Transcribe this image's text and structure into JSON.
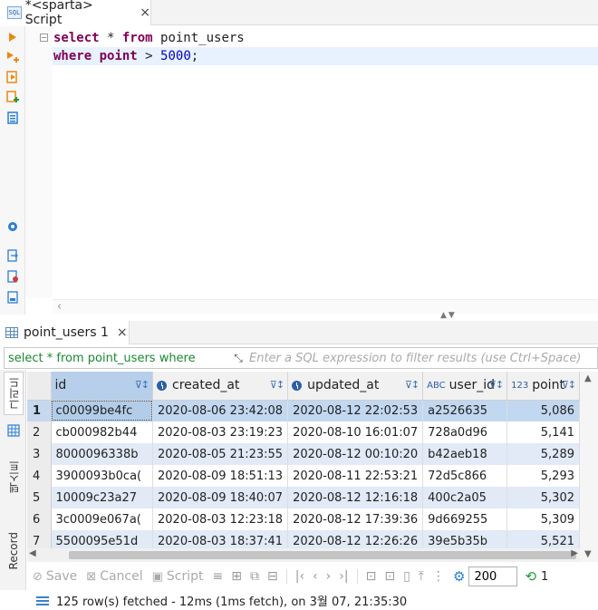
{
  "editor_tab": {
    "title": "*<sparta> Script",
    "close_glyph": "×"
  },
  "editor": {
    "lines": [
      {
        "kw1": "select",
        "text1": " * ",
        "kw2": "from",
        "text2": " point_users"
      },
      {
        "kw1": "where",
        "text1": " ",
        "kw2": "point",
        "text2": " > ",
        "num": "5000",
        "end": ";"
      }
    ]
  },
  "results_tab": {
    "title": "point_users 1",
    "close_glyph": "×"
  },
  "filter": {
    "query_text": "select * from point_users where",
    "placeholder": "Enter a SQL expression to filter results (use Ctrl+Space)"
  },
  "side_tabs": {
    "grid_label": "그리드",
    "text_label": "텍스트",
    "record_label": "Record"
  },
  "grid": {
    "columns": [
      {
        "label": "id",
        "icon": ""
      },
      {
        "label": "created_at",
        "icon": "clock"
      },
      {
        "label": "updated_at",
        "icon": "clock"
      },
      {
        "label": "user_id",
        "icon": "ABC"
      },
      {
        "label": "point",
        "icon": "123"
      }
    ],
    "rows": [
      {
        "n": "1",
        "id": "c00099be4fc",
        "created_at": "2020-08-06 23:42:08",
        "updated_at": "2020-08-12 22:02:53",
        "user_id": "a2526635",
        "point": "5,086"
      },
      {
        "n": "2",
        "id": "cb000982b44",
        "created_at": "2020-08-03 23:19:23",
        "updated_at": "2020-08-10 16:01:07",
        "user_id": "728a0d96",
        "point": "5,141"
      },
      {
        "n": "3",
        "id": "8000096338b",
        "created_at": "2020-08-05 21:23:55",
        "updated_at": "2020-08-12 00:10:20",
        "user_id": "b42aeb18",
        "point": "5,289"
      },
      {
        "n": "4",
        "id": "3900093b0ca(",
        "created_at": "2020-08-09 18:51:13",
        "updated_at": "2020-08-11 22:53:21",
        "user_id": "72d5c866",
        "point": "5,293"
      },
      {
        "n": "5",
        "id": "10009c23a27",
        "created_at": "2020-08-09 18:40:07",
        "updated_at": "2020-08-12 12:16:18",
        "user_id": "400c2a05",
        "point": "5,302"
      },
      {
        "n": "6",
        "id": "3c0009e067a(",
        "created_at": "2020-08-03 12:23:18",
        "updated_at": "2020-08-12 17:39:36",
        "user_id": "9d669255",
        "point": "5,309"
      },
      {
        "n": "7",
        "id": "5500095e51d",
        "created_at": "2020-08-03 18:37:41",
        "updated_at": "2020-08-12 12:26:26",
        "user_id": "39e5b35b",
        "point": "5,521"
      }
    ]
  },
  "toolbar": {
    "save_label": "Save",
    "cancel_label": "Cancel",
    "script_label": "Script",
    "fetch_size": "200",
    "trailing_count": "1"
  },
  "status": {
    "message": "125 row(s) fetched - 12ms (1ms fetch), on 3월 07, 21:35:30"
  },
  "colors": {
    "keyword": "#7f0055",
    "number": "#0000c0",
    "filter_text": "#198a30",
    "selection": "#c2d7f0"
  }
}
